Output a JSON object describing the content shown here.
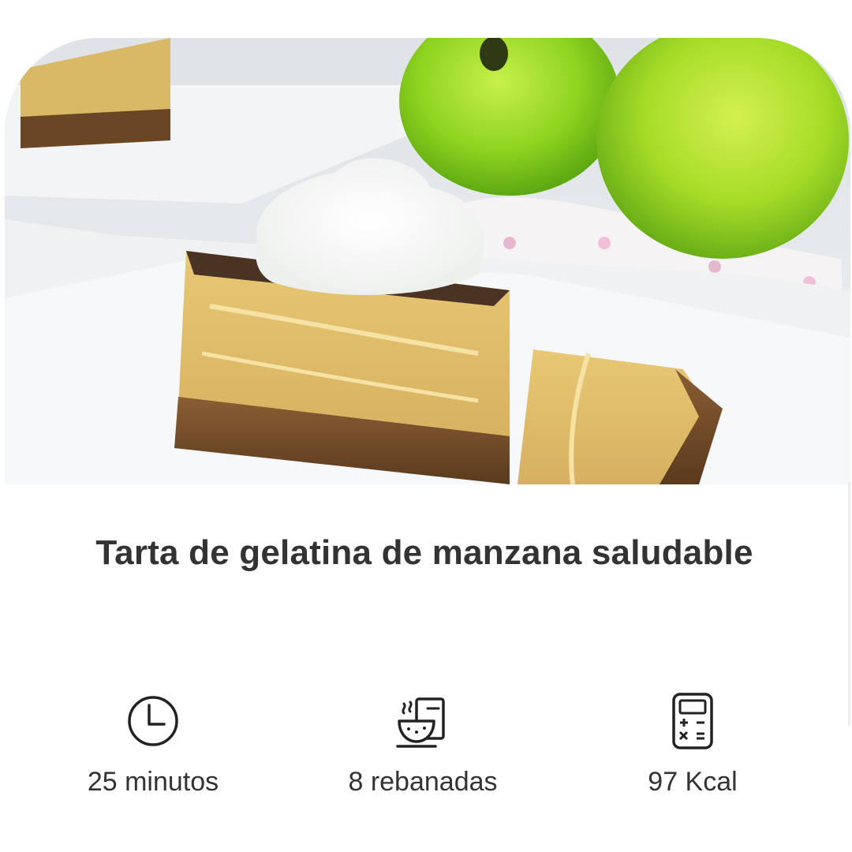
{
  "recipe": {
    "title": "Tarta de gelatina de manzana saludable",
    "image_alt": "Tarta de gelatina de manzana con nata y manzanas verdes",
    "stats": {
      "time": {
        "icon": "clock-icon",
        "label": "25 minutos"
      },
      "servings": {
        "icon": "bowl-icon",
        "label": "8 rebanadas"
      },
      "kcal": {
        "icon": "calculator-icon",
        "label": "97 Kcal"
      }
    }
  },
  "colors": {
    "text": "#333333",
    "background": "#ffffff",
    "apple_green": "#8fd420",
    "cake_yellow": "#e0c06a",
    "crust_brown": "#6a4a2a"
  }
}
